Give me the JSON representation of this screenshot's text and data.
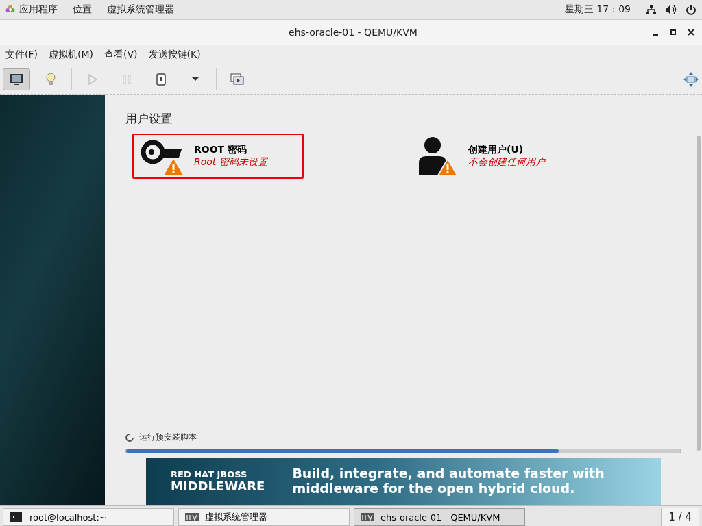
{
  "top_panel": {
    "menus": [
      "应用程序",
      "位置",
      "虚拟系统管理器"
    ],
    "clock": "星期三 17：09"
  },
  "window": {
    "title": "ehs-oracle-01 - QEMU/KVM"
  },
  "menubar": [
    "文件(F)",
    "虚拟机(M)",
    "查看(V)",
    "发送按键(K)"
  ],
  "toolbar": [
    {
      "kind": "console",
      "selected": true,
      "disabled": false
    },
    {
      "kind": "details",
      "selected": false,
      "disabled": false
    },
    {
      "kind": "run",
      "selected": false,
      "disabled": true
    },
    {
      "kind": "pause",
      "selected": false,
      "disabled": true
    },
    {
      "kind": "shutdown",
      "selected": false,
      "disabled": false
    },
    {
      "kind": "dropdown",
      "selected": false,
      "disabled": false
    },
    {
      "kind": "snapshots",
      "selected": false,
      "disabled": false
    }
  ],
  "section_title": "用户设置",
  "spokes": [
    {
      "kind": "key",
      "title": "ROOT 密码",
      "status": "Root 密码未设置",
      "selected": true
    },
    {
      "kind": "user",
      "title": "创建用户(U)",
      "status": "不会创建任何用户",
      "selected": false
    }
  ],
  "progress": {
    "label": "运行预安装脚本",
    "level": 0.78
  },
  "banner": {
    "brand": "RED HAT JBOSS",
    "product": "MIDDLEWARE",
    "headline": "Build, integrate, and automate faster with",
    "subline": "middleware for the open hybrid cloud."
  },
  "taskbar": {
    "items": [
      {
        "label": "root@localhost:~",
        "kind": "terminal",
        "selected": false
      },
      {
        "label": "虚拟系统管理器",
        "kind": "vm",
        "selected": false
      },
      {
        "label": "ehs-oracle-01 - QEMU/KVM",
        "kind": "vm",
        "selected": true
      }
    ],
    "workspace": "1 / 4"
  }
}
